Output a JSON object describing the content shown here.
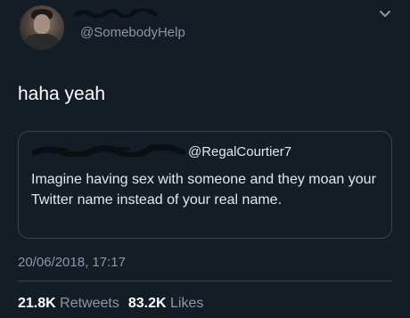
{
  "author": {
    "handle": "@SomebodyHelp",
    "avatar_icon": "profile-photo"
  },
  "tweet": {
    "text": "haha yeah",
    "timestamp": "20/06/2018, 17:17"
  },
  "quoted_tweet": {
    "handle": "@RegalCourtier7",
    "text": "Imagine having sex with someone and they moan your Twitter name instead of your real name."
  },
  "stats": {
    "retweets_count": "21.8K",
    "retweets_label": "Retweets",
    "likes_count": "83.2K",
    "likes_label": "Likes"
  },
  "menu": {
    "icon": "chevron-down-icon"
  },
  "colors": {
    "background": "#141d26",
    "secondary_text": "#8899a6",
    "border": "#38444d"
  }
}
